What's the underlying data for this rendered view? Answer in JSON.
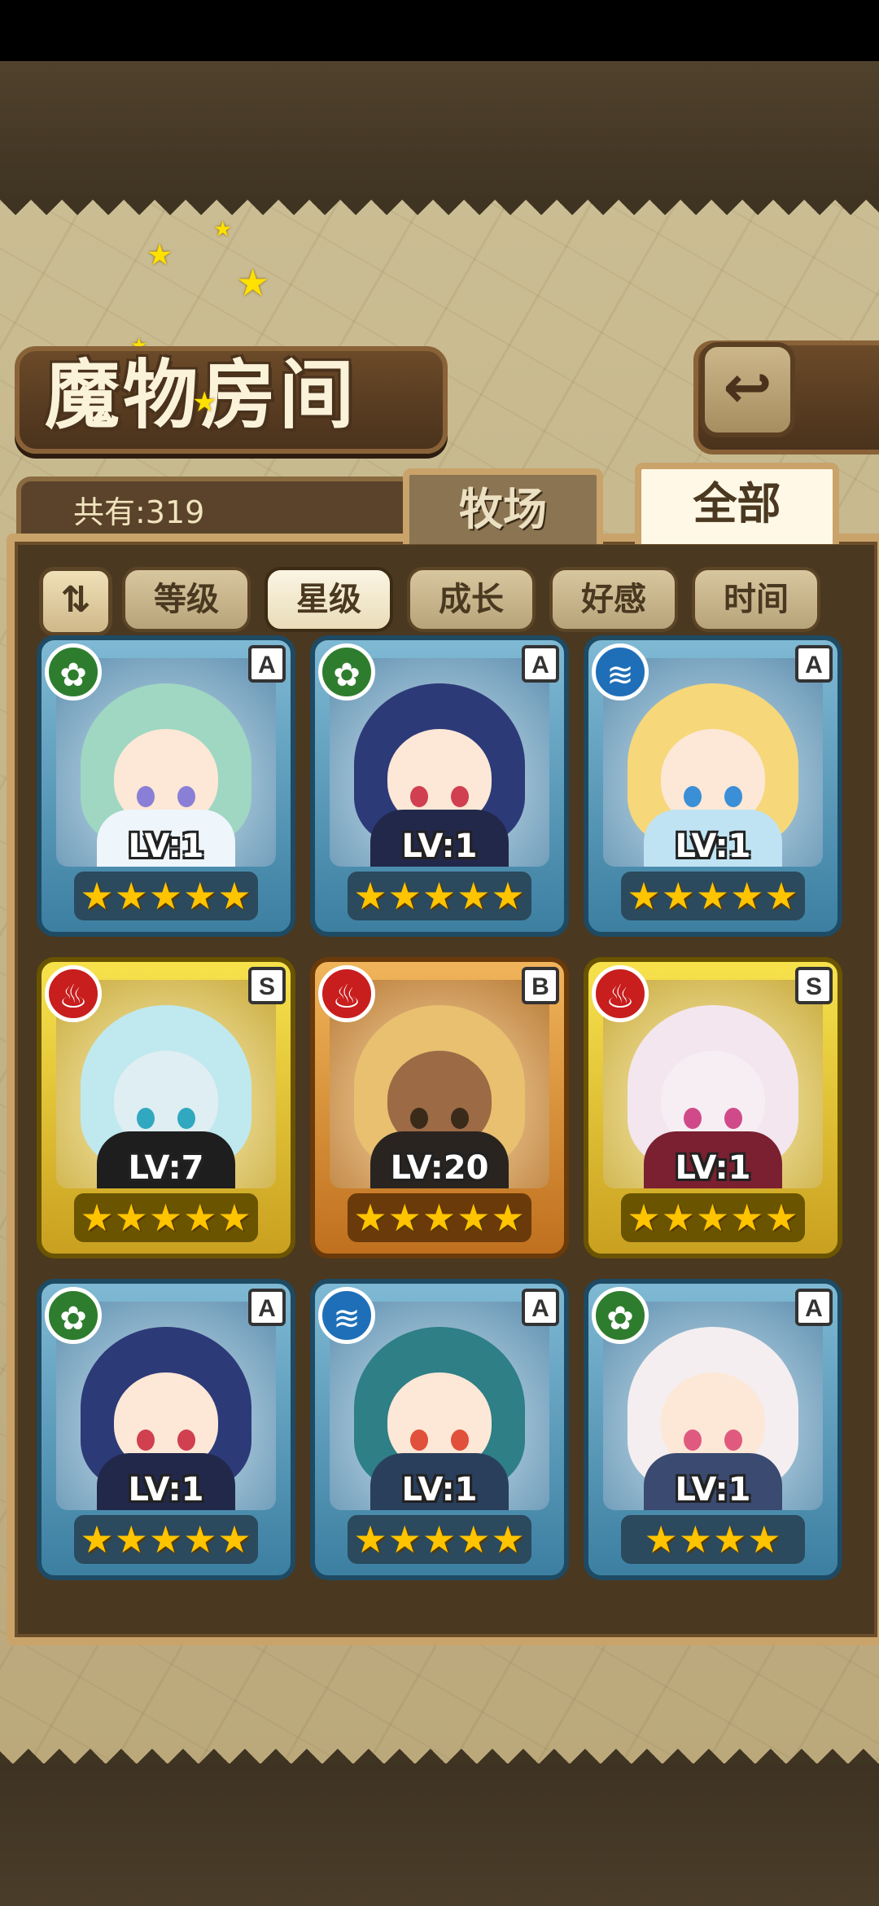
{
  "header": {
    "title": "魔物房间",
    "back_icon": "return-arrow-icon",
    "back_glyph": "↩"
  },
  "summary": {
    "count_label": "共有:319"
  },
  "tabs": [
    {
      "label": "牧场"
    },
    {
      "label": "全部"
    }
  ],
  "sort": {
    "toggle_glyph": "⇅",
    "buttons": [
      {
        "label": "等级"
      },
      {
        "label": "星级"
      },
      {
        "label": "成长"
      },
      {
        "label": "好感"
      },
      {
        "label": "时间"
      }
    ],
    "active": "星级"
  },
  "monsters": [
    {
      "rank": "A",
      "element": "grass",
      "element_glyph": "✿",
      "level": "LV:1",
      "stars": "★★★★★"
    },
    {
      "rank": "A",
      "element": "grass",
      "element_glyph": "✿",
      "level": "LV:1",
      "stars": "★★★★★"
    },
    {
      "rank": "A",
      "element": "water",
      "element_glyph": "≋",
      "level": "LV:1",
      "stars": "★★★★★"
    },
    {
      "rank": "S",
      "element": "fire",
      "element_glyph": "♨",
      "level": "LV:7",
      "stars": "★★★★★"
    },
    {
      "rank": "B",
      "element": "fire",
      "element_glyph": "♨",
      "level": "LV:20",
      "stars": "★★★★★"
    },
    {
      "rank": "S",
      "element": "fire",
      "element_glyph": "♨",
      "level": "LV:1",
      "stars": "★★★★★"
    },
    {
      "rank": "A",
      "element": "grass",
      "element_glyph": "✿",
      "level": "LV:1",
      "stars": "★★★★★"
    },
    {
      "rank": "A",
      "element": "water",
      "element_glyph": "≋",
      "level": "LV:1",
      "stars": "★★★★★"
    },
    {
      "rank": "A",
      "element": "grass",
      "element_glyph": "✿",
      "level": "LV:1",
      "stars": "★★★★"
    }
  ],
  "colors": {
    "grass": "#2e7d2e",
    "water": "#1f6fb8",
    "fire": "#c81e1e",
    "rank_A": "#3c7fa1",
    "rank_S": "#c9a020",
    "rank_B": "#c0701e",
    "star": "#ffc400"
  }
}
